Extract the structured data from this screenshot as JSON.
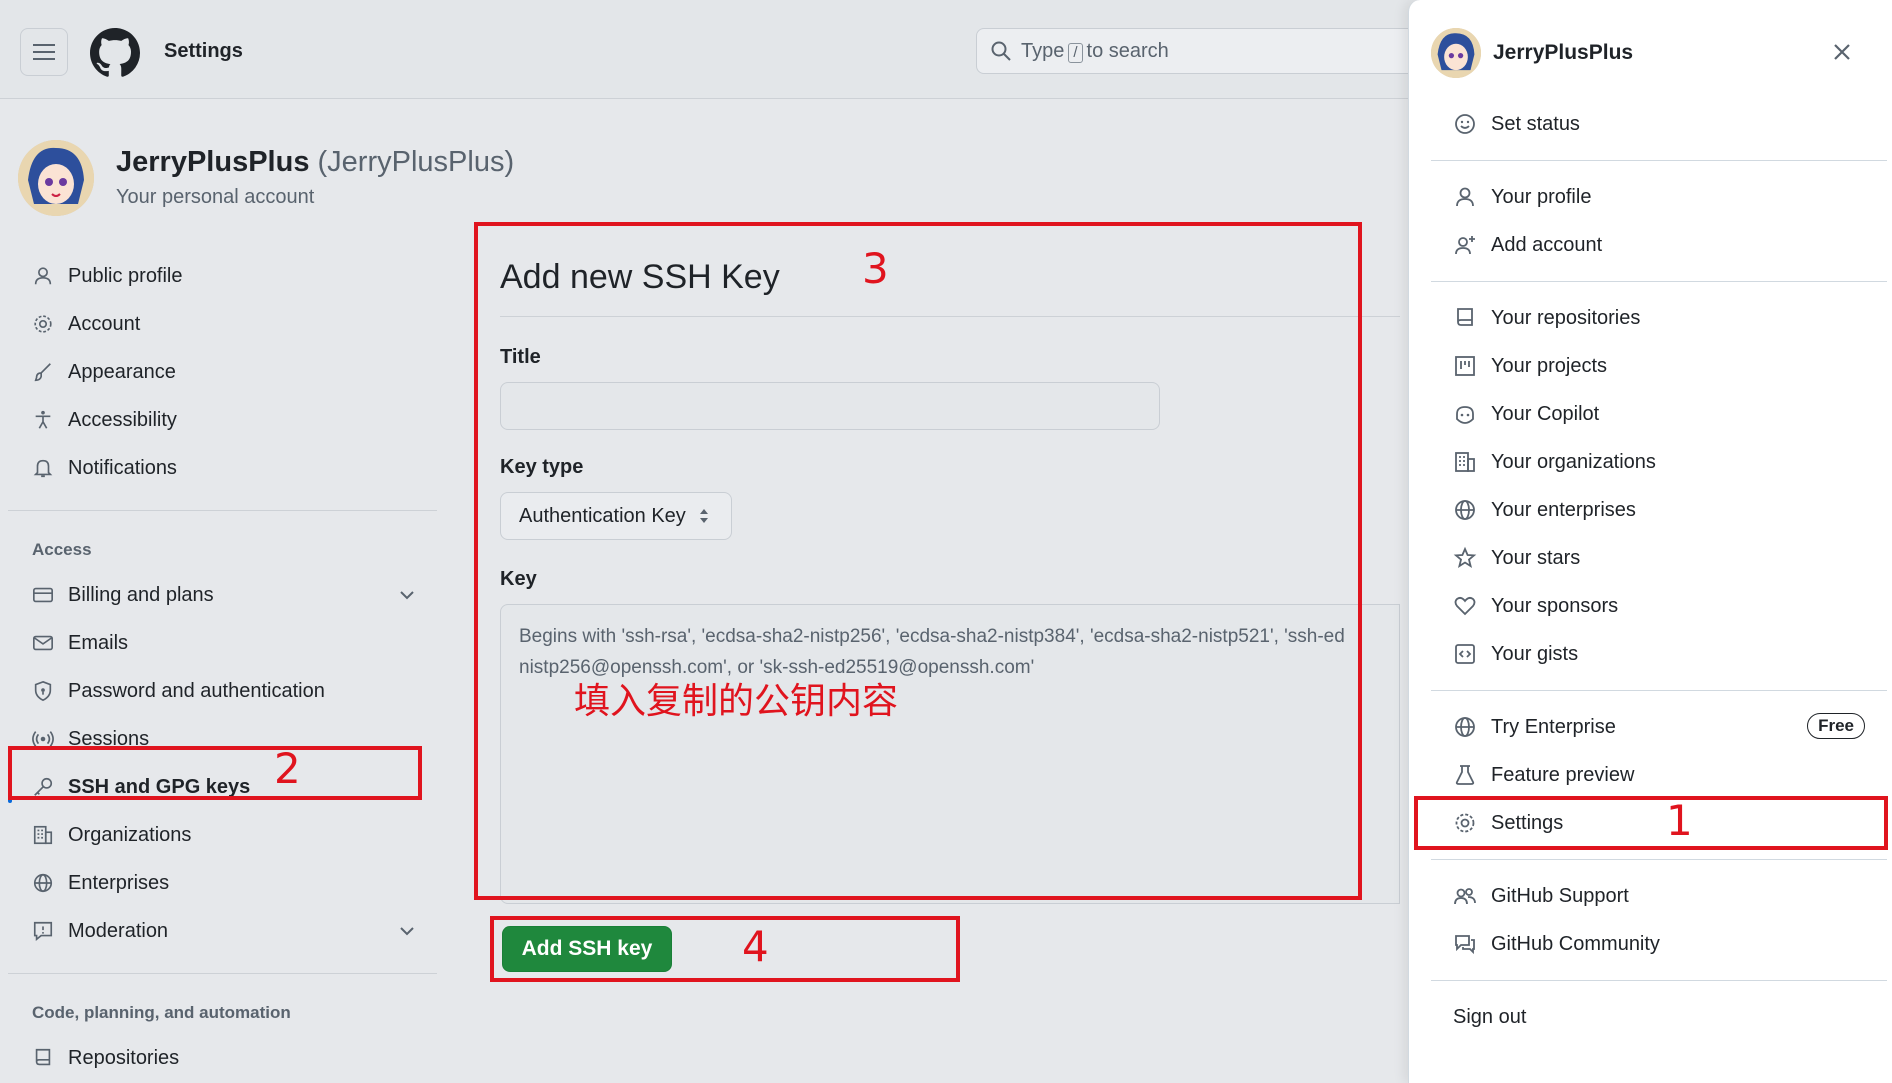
{
  "topbar": {
    "title": "Settings",
    "search_before": "Type",
    "search_key": "/",
    "search_after": "to search"
  },
  "account": {
    "name": "JerryPlusPlus",
    "handle": "(JerryPlusPlus)",
    "subtitle": "Your personal account"
  },
  "sidebar": {
    "group1": [
      "Public profile",
      "Account",
      "Appearance",
      "Accessibility",
      "Notifications"
    ],
    "access_heading": "Access",
    "group2": [
      "Billing and plans",
      "Emails",
      "Password and authentication",
      "Sessions",
      "SSH and GPG keys",
      "Organizations",
      "Enterprises",
      "Moderation"
    ],
    "code_heading": "Code, planning, and automation",
    "group3": [
      "Repositories"
    ]
  },
  "main": {
    "title": "Add new SSH Key",
    "title_label": "Title",
    "keytype_label": "Key type",
    "keytype_value": "Authentication Key",
    "key_label": "Key",
    "key_placeholder_line1": "Begins with 'ssh-rsa', 'ecdsa-sha2-nistp256', 'ecdsa-sha2-nistp384', 'ecdsa-sha2-nistp521', 'ssh-ed",
    "key_placeholder_line2": "nistp256@openssh.com', or 'sk-ssh-ed25519@openssh.com'",
    "submit": "Add SSH key"
  },
  "annotations": {
    "note": "填入复制的公钥内容",
    "n1": "1",
    "n2": "2",
    "n3": "3",
    "n4": "4",
    "color": "#e0141e"
  },
  "user_menu": {
    "name": "JerryPlusPlus",
    "set_status": "Set status",
    "items_a": [
      "Your profile",
      "Add account"
    ],
    "items_b": [
      "Your repositories",
      "Your projects",
      "Your Copilot",
      "Your organizations",
      "Your enterprises",
      "Your stars",
      "Your sponsors",
      "Your gists"
    ],
    "try_enterprise": "Try Enterprise",
    "free_badge": "Free",
    "feature_preview": "Feature preview",
    "settings": "Settings",
    "support": "GitHub Support",
    "community": "GitHub Community",
    "sign_out": "Sign out"
  }
}
